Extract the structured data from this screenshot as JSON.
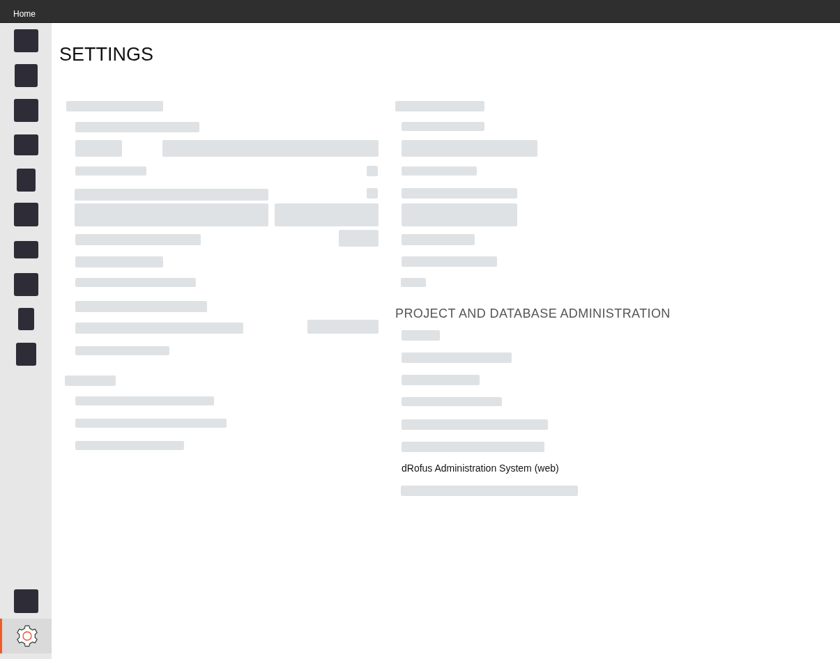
{
  "menu_bar": {
    "items": [
      {
        "label": "Home"
      }
    ]
  },
  "sidebar": {
    "items": [
      {
        "kind": "placeholder",
        "selected": false
      },
      {
        "kind": "placeholder",
        "selected": false
      },
      {
        "kind": "placeholder",
        "selected": false
      },
      {
        "kind": "placeholder",
        "selected": false
      },
      {
        "kind": "placeholder",
        "selected": false
      },
      {
        "kind": "placeholder",
        "selected": false
      },
      {
        "kind": "placeholder",
        "selected": false
      },
      {
        "kind": "placeholder",
        "selected": false
      },
      {
        "kind": "placeholder",
        "selected": false
      },
      {
        "kind": "placeholder",
        "selected": false
      }
    ],
    "bottom_items": [
      {
        "kind": "placeholder",
        "selected": false
      },
      {
        "kind": "settings",
        "selected": true
      }
    ]
  },
  "content": {
    "title": "SETTINGS",
    "admin_section": {
      "heading": "PROJECT AND DATABASE ADMINISTRATION",
      "link": "dRofus Administration System (web)"
    }
  }
}
